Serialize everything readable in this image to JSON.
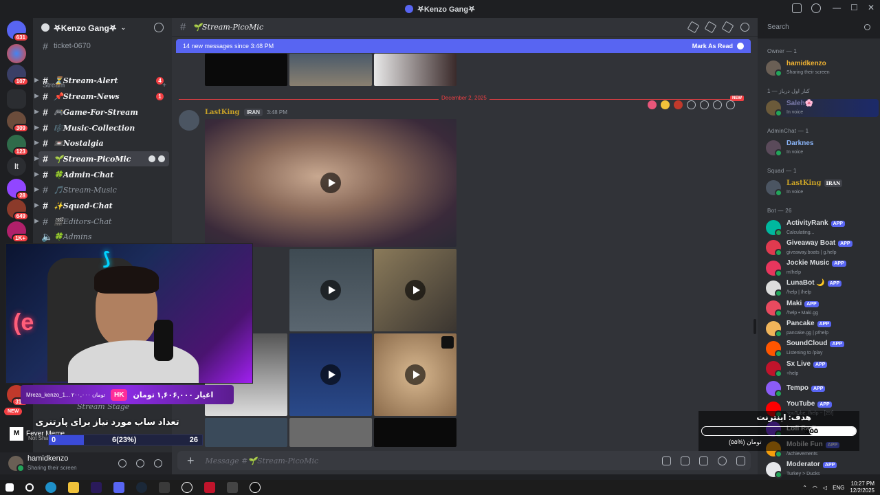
{
  "window": {
    "title": "𖤐Kenzo Gang𖤐",
    "controls": [
      "—",
      "☐",
      "✕"
    ]
  },
  "rail": {
    "badges": [
      "631",
      "107",
      "309",
      "123",
      "28",
      "649",
      "1K+",
      "31K"
    ],
    "lt": "lt"
  },
  "sidebar": {
    "guild_name": "𖤐Kenzo Gang𖤐",
    "top_channel": "ticket-0670",
    "category": "Stream",
    "channels": [
      {
        "label": "⏳Stream-Alert",
        "badge": "4"
      },
      {
        "label": "📌Stream-News",
        "badge": "1"
      },
      {
        "label": "🎮Game-For-Stream"
      },
      {
        "label": "🎼Music-Collection"
      },
      {
        "label": "📼Nostalgia"
      },
      {
        "label": "🌱Stream-PicoMic"
      },
      {
        "label": "🍀Admin-Chat"
      },
      {
        "label": "🎵Stream-Music"
      },
      {
        "label": "✨Squad-Chat"
      },
      {
        "label": "🎬Editors-Chat"
      },
      {
        "label": "🍀Admins"
      }
    ],
    "stage": "Stream Stage"
  },
  "user": {
    "name": "hamidkenzo",
    "status": "Sharing their screen"
  },
  "channel": {
    "name": "🌱Stream-PicoMic",
    "placeholder": "Message #🌱Stream-PicoMic"
  },
  "newbar": {
    "text": "14 new messages since 3:48 PM",
    "action": "Mark As Read"
  },
  "divider": {
    "date": "December 2, 2025",
    "tag": "NEW"
  },
  "message": {
    "author": "LastKing",
    "tag": "IRAN",
    "time": "3:48 PM"
  },
  "search": {
    "placeholder": "Search"
  },
  "members": {
    "owner_group": "Owner — 1",
    "owner": {
      "name": "hamidkenzo",
      "status": "Sharing their screen"
    },
    "g2": "کنار اول درباز — 1",
    "m2": {
      "name": "Saleh🌸",
      "status": "In voice"
    },
    "g3": "AdminChat — 1",
    "m3": {
      "name": "Darknes",
      "status": "In voice"
    },
    "g4": "Squad — 1",
    "m4": {
      "name": "LastKing",
      "tag": "IRAN",
      "status": "In voice"
    },
    "g5": "Bot — 26",
    "app_label": "APP",
    "bots": [
      {
        "name": "ActivityRank",
        "status": "Calculating...",
        "color": "#00b89f"
      },
      {
        "name": "Giveaway Boat",
        "status": "giveaway.boats | g.help",
        "color": "#e03a4f"
      },
      {
        "name": "Jockie Music",
        "status": "m!help",
        "color": "#e8365d"
      },
      {
        "name": "LunaBot 🌙",
        "status": "/help | /help",
        "color": "#dcdcdc"
      },
      {
        "name": "Maki",
        "status": "/help • Maki.gg",
        "color": "#e84a5f"
      },
      {
        "name": "Pancake",
        "status": "pancake.gg | p!help",
        "color": "#f0b45a"
      },
      {
        "name": "SoundCloud",
        "status": "Listening to /play",
        "color": "#ff5500"
      },
      {
        "name": "Sx Live",
        "status": "+help",
        "color": "#c0142b"
      },
      {
        "name": "Tempo",
        "status": "",
        "color": "#8b5cf6"
      },
      {
        "name": "YouTube",
        "status": "YouTube, /help ~ [25!]",
        "color": "#ff0000"
      },
      {
        "name": "Lofi Radio",
        "status": "",
        "color": "#7c3aed"
      },
      {
        "name": "Mobile Fun",
        "status": "/achievements",
        "color": "#f59e0b"
      },
      {
        "name": "Moderator",
        "status": "Turkey > Ducks",
        "color": "#e5e7eb"
      }
    ]
  },
  "overlay": {
    "donation_left": "Mreza_kenzo_1... ۲۰۰,۰۰۰ تومان",
    "donation_logo": "HK",
    "donation_right": "اغیار ۱,۶۰۶,۰۰۰ تومان",
    "sub_goal": "تعداد ساب مورد نیاز برای پارتنری",
    "sub_min": "0",
    "sub_current": "6(23%)",
    "sub_max": "26",
    "sub_fraction": 0.23,
    "music_title": "Fever Meme",
    "music_sub": "Not Shar",
    "new_label": "NEW",
    "goal_title": "هدف: اینترنت",
    "goal_percent": "%۵۵",
    "goal_fraction": 0.55,
    "goal_sub": "تومان (%۵۵)"
  },
  "taskbar": {
    "lang": "ENG",
    "time": "10:27 PM",
    "date": "12/2/2025"
  }
}
